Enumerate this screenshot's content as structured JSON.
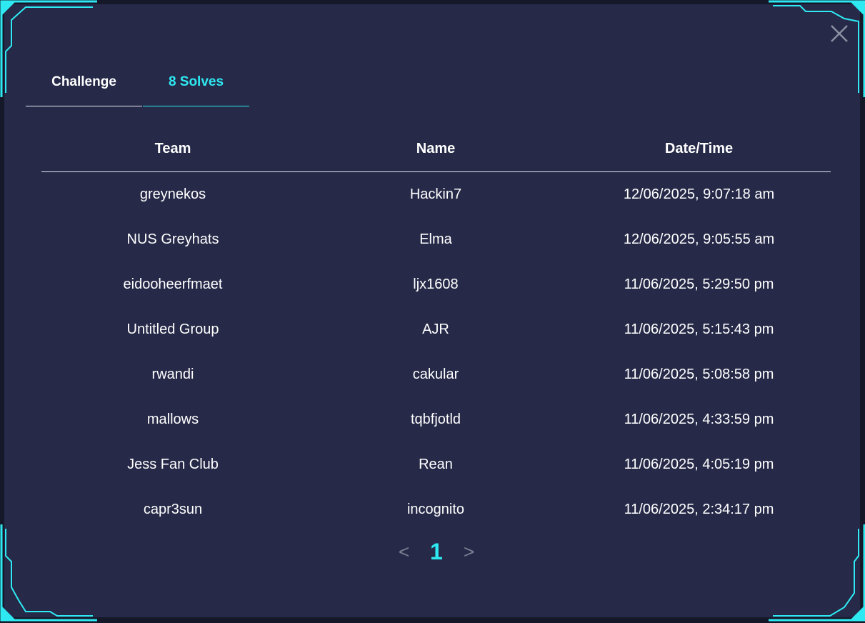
{
  "modal": {
    "close_label": "close"
  },
  "tabs": [
    {
      "label": "Challenge",
      "active": false
    },
    {
      "label": "8 Solves",
      "active": true
    }
  ],
  "table": {
    "headers": [
      "Team",
      "Name",
      "Date/Time"
    ],
    "rows": [
      {
        "team": "greynekos",
        "name": "Hackin7",
        "datetime": "12/06/2025, 9:07:18 am"
      },
      {
        "team": "NUS Greyhats",
        "name": "Elma",
        "datetime": "12/06/2025, 9:05:55 am"
      },
      {
        "team": "eidooheerfmaet",
        "name": "ljx1608",
        "datetime": "11/06/2025, 5:29:50 pm"
      },
      {
        "team": "Untitled Group",
        "name": "AJR",
        "datetime": "11/06/2025, 5:15:43 pm"
      },
      {
        "team": "rwandi",
        "name": "cakular",
        "datetime": "11/06/2025, 5:08:58 pm"
      },
      {
        "team": "mallows",
        "name": "tqbfjotld",
        "datetime": "11/06/2025, 4:33:59 pm"
      },
      {
        "team": "Jess Fan Club",
        "name": "Rean",
        "datetime": "11/06/2025, 4:05:19 pm"
      },
      {
        "team": "capr3sun",
        "name": "incognito",
        "datetime": "11/06/2025, 2:34:17 pm"
      }
    ]
  },
  "pagination": {
    "prev": "<",
    "current": "1",
    "next": ">"
  },
  "colors": {
    "accent": "#2ee9f2",
    "modal_bg": "#262a48",
    "text": "#ffffff",
    "muted": "#7c8193"
  },
  "icons": {
    "close": "close-icon",
    "corner": "corner-frame-decoration"
  }
}
